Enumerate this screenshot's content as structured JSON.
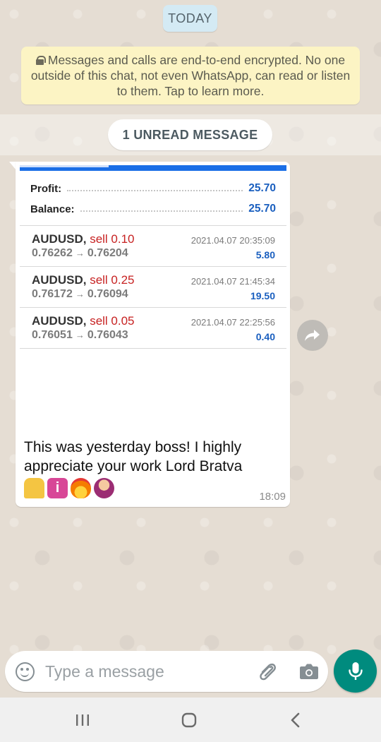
{
  "date_divider": "TODAY",
  "encryption_notice": "Messages and calls are end-to-end encrypted. No one outside of this chat, not even WhatsApp, can read or listen to them. Tap to learn more.",
  "unread_banner": "1 UNREAD MESSAGE",
  "message": {
    "screenshot": {
      "summary": [
        {
          "label": "Profit:",
          "value": "25.70"
        },
        {
          "label": "Balance:",
          "value": "25.70"
        }
      ],
      "trades": [
        {
          "symbol": "AUDUSD,",
          "side": "sell 0.10",
          "open": "0.76262",
          "close": "0.76204",
          "time": "2021.04.07 20:35:09",
          "profit": "5.80"
        },
        {
          "symbol": "AUDUSD,",
          "side": "sell 0.25",
          "open": "0.76172",
          "close": "0.76094",
          "time": "2021.04.07 21:45:34",
          "profit": "19.50"
        },
        {
          "symbol": "AUDUSD,",
          "side": "sell 0.05",
          "open": "0.76051",
          "close": "0.76043",
          "time": "2021.04.07 22:25:56",
          "profit": "0.40"
        }
      ],
      "arrow": "→"
    },
    "text": "This was yesterday boss! I highly appreciate your work Lord Bratva",
    "emojis": [
      "pray-emoji",
      "information-emoji",
      "fire-emoji",
      "person-in-lotus-emoji"
    ],
    "time": "18:09"
  },
  "composer": {
    "placeholder": "Type a message"
  },
  "icons": {
    "emoji": "smiley-icon",
    "attach": "paperclip-icon",
    "camera": "camera-icon",
    "mic": "microphone-icon",
    "forward": "forward-icon",
    "lock": "lock-icon"
  },
  "colors": {
    "accent": "#008b7e",
    "profit_blue": "#1a5fbf",
    "sell_red": "#c72222",
    "notice_bg": "#fcf4c4"
  }
}
